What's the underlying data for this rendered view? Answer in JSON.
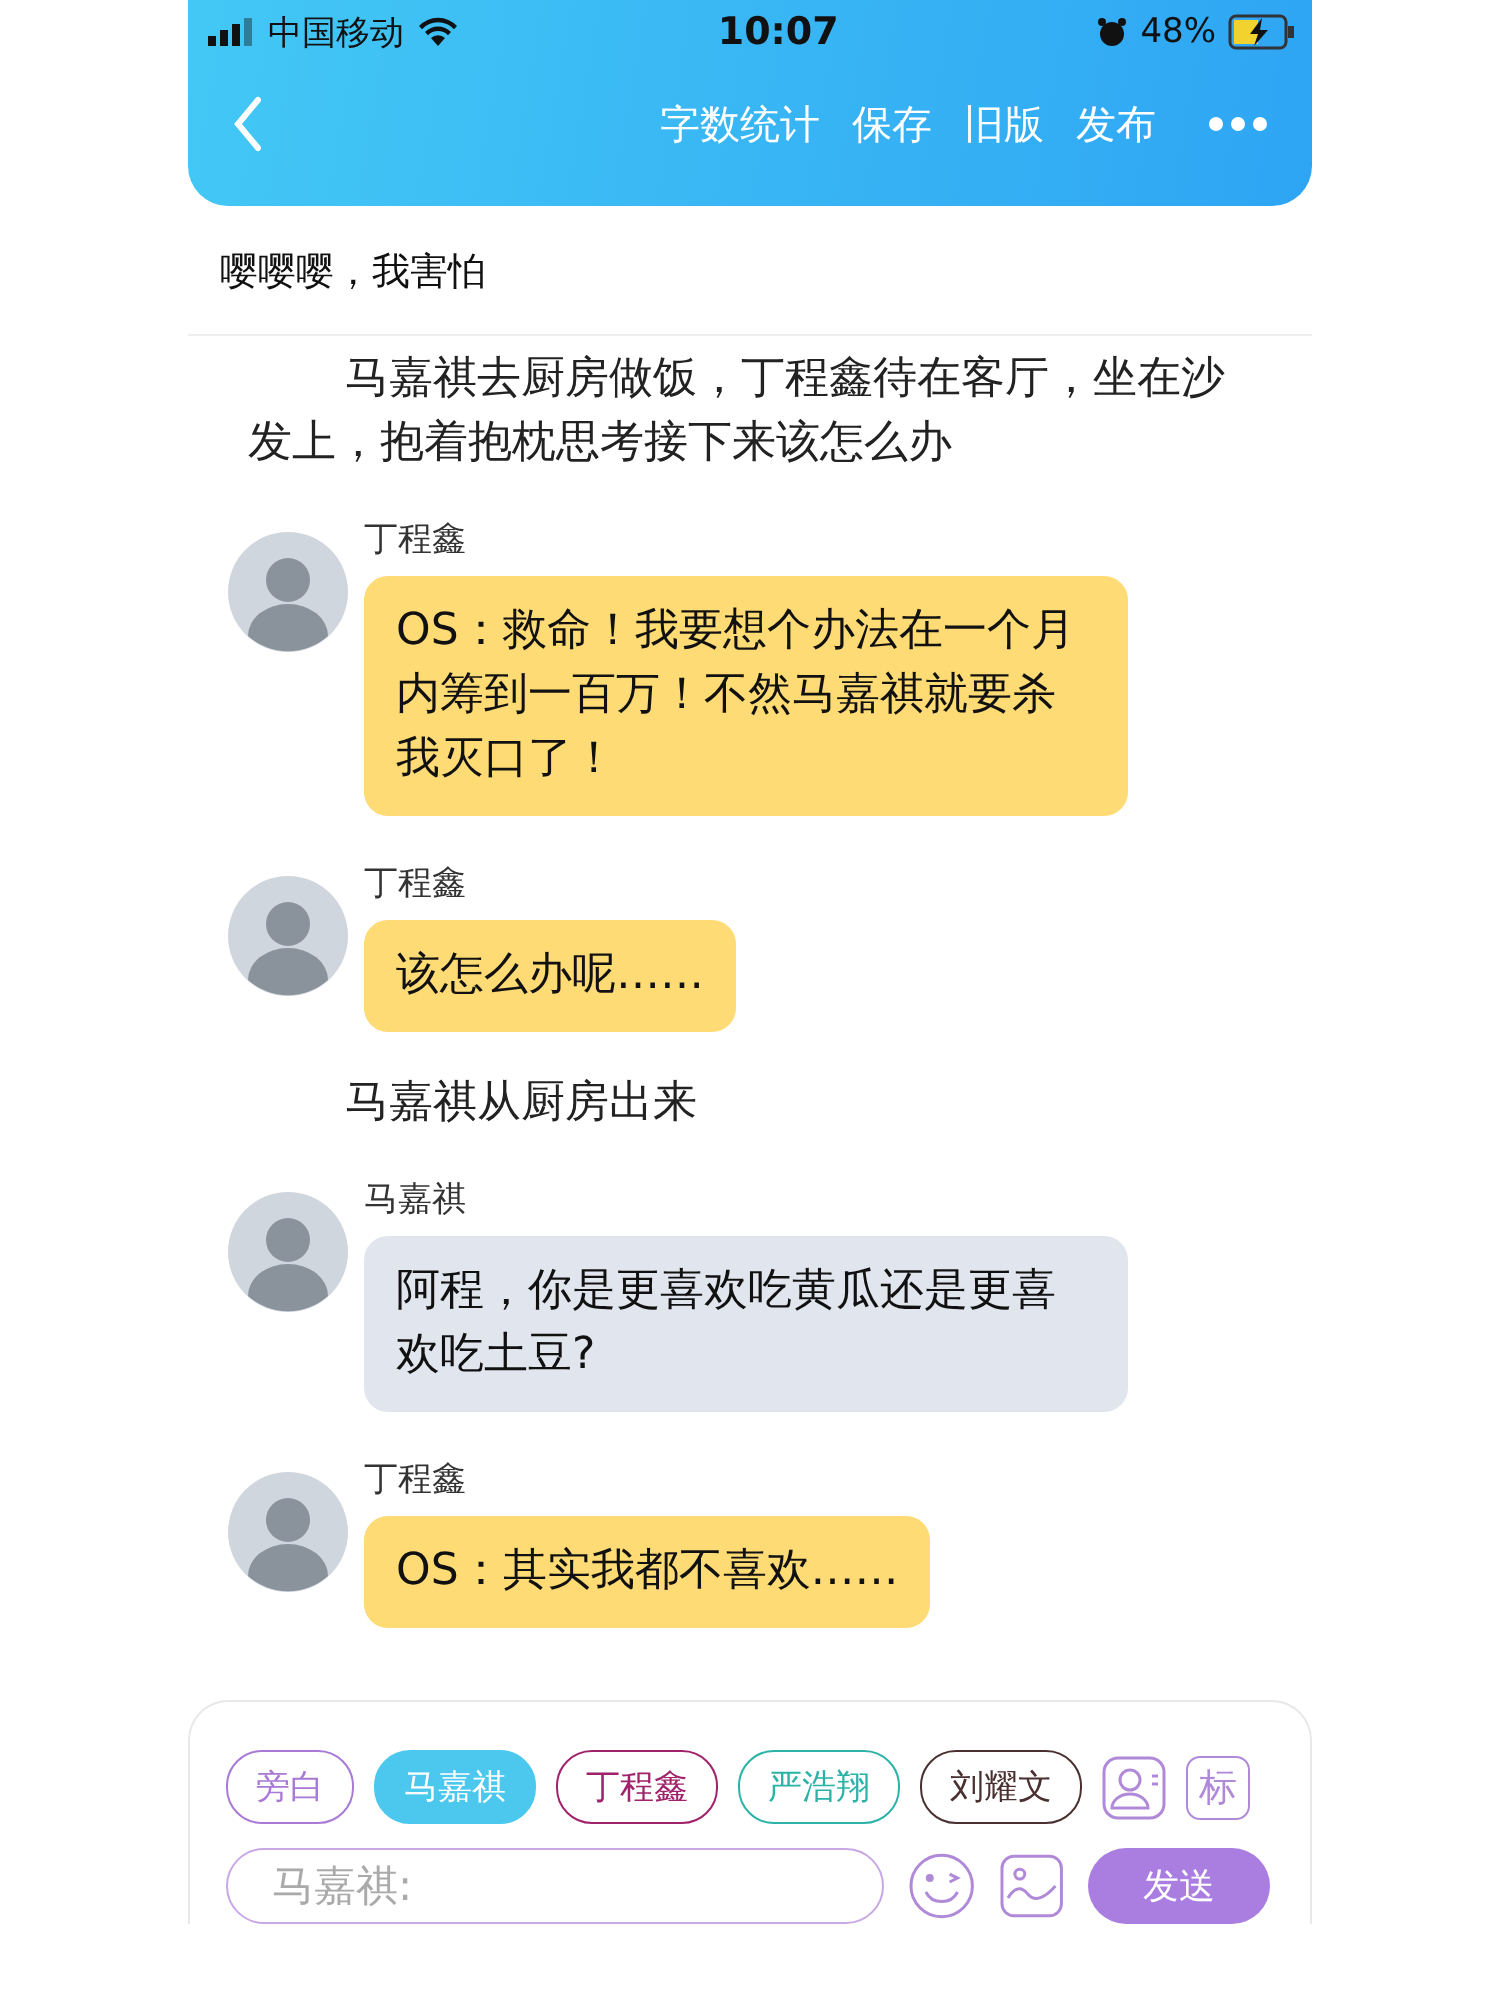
{
  "status_bar": {
    "carrier": "中国移动",
    "time": "10:07",
    "battery": "48%",
    "charging": true
  },
  "nav": {
    "actions": [
      "字数统计",
      "保存",
      "旧版",
      "发布"
    ]
  },
  "title": "嘤嘤嘤，我害怕",
  "messages": [
    {
      "kind": "narration",
      "text": "马嘉祺去厨房做饭，丁程鑫待在客厅，坐在沙发上，抱着抱枕思考接下来该怎么办"
    },
    {
      "kind": "chat",
      "speaker": "丁程鑫",
      "color": "#fedb74",
      "text": "OS：救命！我要想个办法在一个月内筹到一百万！不然马嘉祺就要杀我灭口了！"
    },
    {
      "kind": "chat",
      "speaker": "丁程鑫",
      "color": "#fedb74",
      "text": "该怎么办呢……"
    },
    {
      "kind": "narration",
      "text": "马嘉祺从厨房出来"
    },
    {
      "kind": "chat",
      "speaker": "马嘉祺",
      "color": "#e1e6ee",
      "text": "阿程，你是更喜欢吃黄瓜还是更喜欢吃土豆?"
    },
    {
      "kind": "chat",
      "speaker": "丁程鑫",
      "color": "#fedb74",
      "text": "OS：其实我都不喜欢……"
    }
  ],
  "roles": [
    {
      "label": "旁白",
      "color": "#a979d6",
      "selected": false
    },
    {
      "label": "马嘉祺",
      "color": "#4cc8ee",
      "selected": true
    },
    {
      "label": "丁程鑫",
      "color": "#a0226a",
      "selected": false
    },
    {
      "label": "严浩翔",
      "color": "#2cb3a8",
      "selected": false
    },
    {
      "label": "刘耀文",
      "color": "#4a3030",
      "selected": false
    }
  ],
  "mark_button": "标",
  "input": {
    "placeholder": "马嘉祺:"
  },
  "send_button": "发送"
}
